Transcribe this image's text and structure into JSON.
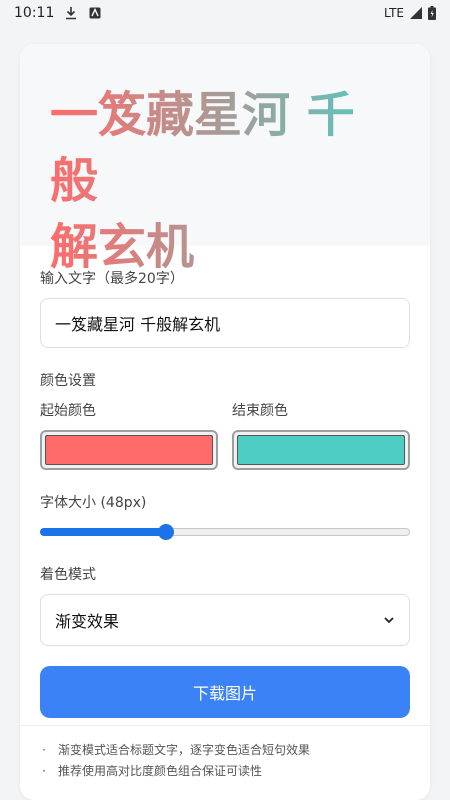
{
  "status_bar": {
    "time": "10:11",
    "network": "LTE"
  },
  "preview": {
    "line1": "一笈藏星河 千般",
    "line2": "解玄机"
  },
  "form": {
    "text_label": "输入文字（最多20字）",
    "text_value": "一笈藏星河 千般解玄机",
    "color_section_label": "颜色设置",
    "start_color_label": "起始颜色",
    "start_color": "#ff6b6b",
    "end_color_label": "结束颜色",
    "end_color": "#4ecdc4",
    "font_size_label": "字体大小 (48px)",
    "font_size_value": 48,
    "font_size_fraction": 0.34,
    "mode_label": "着色模式",
    "mode_selected": "渐变效果",
    "download_label": "下载图片"
  },
  "tips": [
    "渐变模式适合标题文字，逐字变色适合短句效果",
    "推荐使用高对比度颜色组合保证可读性"
  ],
  "colors": {
    "accent": "#3b82f6",
    "slider": "#1a73e8"
  },
  "icons": {
    "download_status": "download-icon",
    "app_status": "app-notification-icon",
    "signal": "signal-icon",
    "battery": "battery-icon",
    "dropdown": "chevron-down-icon"
  }
}
